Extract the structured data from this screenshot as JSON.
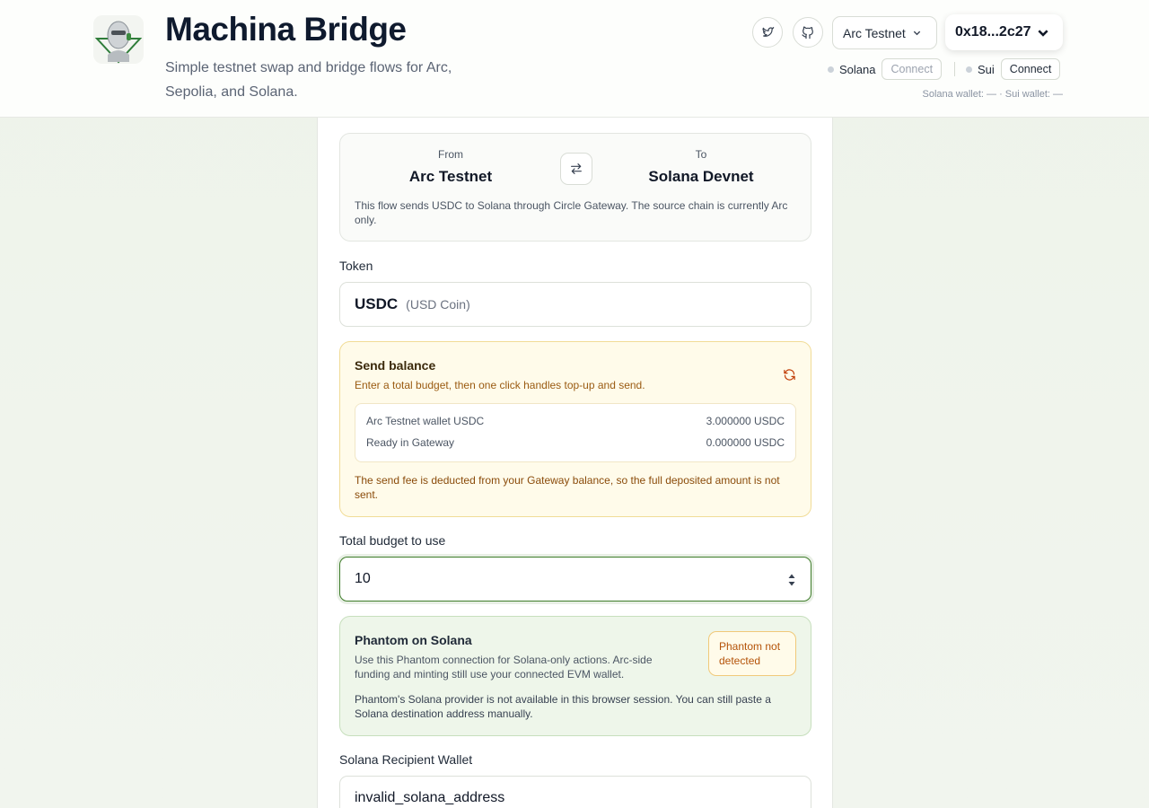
{
  "header": {
    "title": "Machina Bridge",
    "subtitle": "Simple testnet swap and bridge flows for Arc, Sepolia, and Solana.",
    "network_selected": "Arc Testnet",
    "account": "0x18...2c27",
    "solana": {
      "label": "Solana",
      "connect_label": "Connect"
    },
    "sui": {
      "label": "Sui",
      "connect_label": "Connect"
    },
    "wallet_status": "Solana wallet: — · Sui wallet: —",
    "icons": [
      "twitter-icon",
      "github-icon",
      "chevron-down-icon",
      "swap-icon",
      "refresh-icon"
    ]
  },
  "route": {
    "from_label": "From",
    "from_value": "Arc Testnet",
    "to_label": "To",
    "to_value": "Solana Devnet",
    "note": "This flow sends USDC to Solana through Circle Gateway. The source chain is currently Arc only."
  },
  "token": {
    "label": "Token",
    "symbol": "USDC",
    "name": "(USD Coin)"
  },
  "send_balance": {
    "title": "Send balance",
    "description": "Enter a total budget, then one click handles top-up and send.",
    "rows": [
      {
        "label": "Arc Testnet wallet USDC",
        "value": "3.000000 USDC"
      },
      {
        "label": "Ready in Gateway",
        "value": "0.000000 USDC"
      }
    ],
    "note": "The send fee is deducted from your Gateway balance, so the full deposited amount is not sent."
  },
  "budget": {
    "label": "Total budget to use",
    "value": "10"
  },
  "phantom": {
    "title": "Phantom on Solana",
    "description": "Use this Phantom connection for Solana-only actions. Arc-side funding and minting still use your connected EVM wallet.",
    "badge": "Phantom not detected",
    "note": "Phantom's Solana provider is not available in this browser session. You can still paste a Solana destination address manually."
  },
  "recipient": {
    "label": "Solana Recipient Wallet",
    "value": "invalid_solana_address"
  },
  "colors": {
    "accent_green": "#3f7d2a",
    "warning_bg": "#fffbea",
    "warning_border": "#f1dc97",
    "success_bg": "#eef6ea"
  }
}
